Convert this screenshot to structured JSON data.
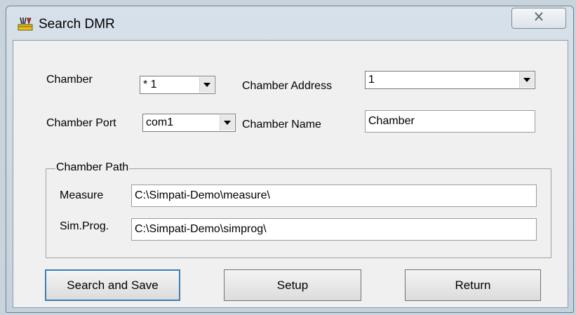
{
  "window": {
    "title": "Search DMR"
  },
  "form": {
    "chamber_label": "Chamber",
    "chamber_value": "* 1",
    "chamber_address_label": "Chamber Address",
    "chamber_address_value": "1",
    "chamber_port_label": "Chamber Port",
    "chamber_port_value": "com1",
    "chamber_name_label": "Chamber Name",
    "chamber_name_value": "Chamber"
  },
  "path_group": {
    "title": "Chamber Path",
    "measure_label": "Measure",
    "measure_value": "C:\\Simpati-Demo\\measure\\",
    "simprog_label": "Sim.Prog.",
    "simprog_value": "C:\\Simpati-Demo\\simprog\\"
  },
  "buttons": {
    "search_save": "Search and Save",
    "setup": "Setup",
    "return": "Return"
  },
  "icons": {
    "app": "app-tools-icon",
    "close": "close-icon",
    "dropdown": "chevron-down-icon"
  }
}
